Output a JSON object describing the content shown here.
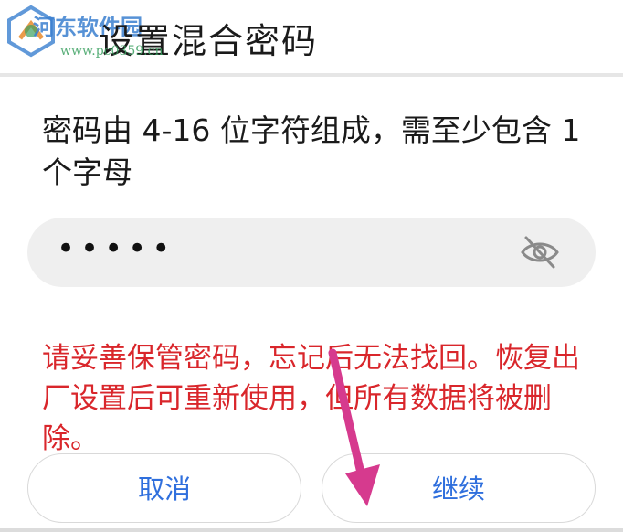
{
  "header": {
    "title": "设置混合密码"
  },
  "watermark": {
    "site_name": "河东软件园",
    "site_url": "www.pc0359.cn"
  },
  "form": {
    "rule_text": "密码由 4-16 位字符组成，需至少包含 1 个字母",
    "password_value": "•••••",
    "warning_text": "请妥善保管密码，忘记后无法找回。恢复出厂设置后可重新使用，但所有数据将被删除。"
  },
  "buttons": {
    "cancel_label": "取消",
    "continue_label": "继续"
  },
  "icons": {
    "visibility_toggle": "eye-off-icon",
    "annotation_arrow": "arrow-down-icon"
  },
  "colors": {
    "warning": "#d9262b",
    "button_text": "#2f6fdd",
    "field_background": "#efefef",
    "annotation_arrow": "#d63a8e"
  }
}
